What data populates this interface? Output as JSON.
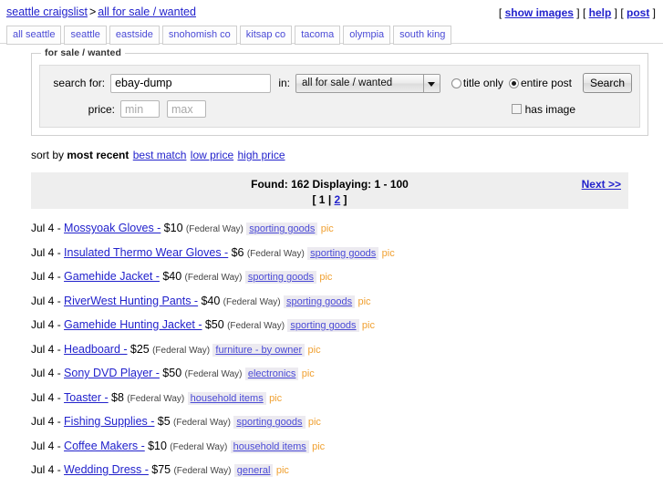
{
  "header": {
    "breadcrumb": {
      "site": "seattle craigslist",
      "separator": ">",
      "section": "all for sale / wanted"
    },
    "top_links": [
      {
        "label": "show images"
      },
      {
        "label": "help"
      },
      {
        "label": "post"
      }
    ]
  },
  "city_nav": [
    {
      "label": "all seattle"
    },
    {
      "label": "seattle"
    },
    {
      "label": "eastside"
    },
    {
      "label": "snohomish co"
    },
    {
      "label": "kitsap co"
    },
    {
      "label": "tacoma"
    },
    {
      "label": "olympia"
    },
    {
      "label": "south king"
    }
  ],
  "search_form": {
    "legend": "for sale / wanted",
    "search_for_label": "search for:",
    "query_value": "ebay-dump",
    "in_label": "in:",
    "category_selected": "all for sale / wanted",
    "scope_options": [
      {
        "label": "title only",
        "selected": false
      },
      {
        "label": "entire post",
        "selected": true
      }
    ],
    "search_button": "Search",
    "price_label": "price:",
    "price_min_placeholder": "min",
    "price_max_placeholder": "max",
    "has_image_label": "has image",
    "has_image_checked": false
  },
  "sort": {
    "prefix": "sort by",
    "current": "most recent",
    "options": [
      {
        "label": "best match"
      },
      {
        "label": "low price"
      },
      {
        "label": "high price"
      }
    ]
  },
  "results_bar": {
    "summary": "Found: 162 Displaying: 1 - 100",
    "pages_open": "[",
    "pages_close": "]",
    "pages_sep": "|",
    "page_current": "1",
    "page_other": "2",
    "next_label": "Next >>"
  },
  "listings": [
    {
      "date": "Jul 4",
      "dash": "-",
      "title": "Mossyoak Gloves -",
      "price": "$10",
      "location": "(Federal Way)",
      "category": "sporting goods",
      "pic": "pic"
    },
    {
      "date": "Jul 4",
      "dash": "-",
      "title": "Insulated Thermo Wear Gloves -",
      "price": "$6",
      "location": "(Federal Way)",
      "category": "sporting goods",
      "pic": "pic"
    },
    {
      "date": "Jul 4",
      "dash": "-",
      "title": "Gamehide Jacket -",
      "price": "$40",
      "location": "(Federal Way)",
      "category": "sporting goods",
      "pic": "pic"
    },
    {
      "date": "Jul 4",
      "dash": "-",
      "title": "RiverWest Hunting Pants -",
      "price": "$40",
      "location": "(Federal Way)",
      "category": "sporting goods",
      "pic": "pic"
    },
    {
      "date": "Jul 4",
      "dash": "-",
      "title": "Gamehide Hunting Jacket -",
      "price": "$50",
      "location": "(Federal Way)",
      "category": "sporting goods",
      "pic": "pic"
    },
    {
      "date": "Jul 4",
      "dash": "-",
      "title": "Headboard -",
      "price": "$25",
      "location": "(Federal Way)",
      "category": "furniture - by owner",
      "pic": "pic"
    },
    {
      "date": "Jul 4",
      "dash": "-",
      "title": "Sony DVD Player -",
      "price": "$50",
      "location": "(Federal Way)",
      "category": "electronics",
      "pic": "pic"
    },
    {
      "date": "Jul 4",
      "dash": "-",
      "title": "Toaster -",
      "price": "$8",
      "location": "(Federal Way)",
      "category": "household items",
      "pic": "pic"
    },
    {
      "date": "Jul 4",
      "dash": "-",
      "title": "Fishing Supplies -",
      "price": "$5",
      "location": "(Federal Way)",
      "category": "sporting goods",
      "pic": "pic"
    },
    {
      "date": "Jul 4",
      "dash": "-",
      "title": "Coffee Makers -",
      "price": "$10",
      "location": "(Federal Way)",
      "category": "household items",
      "pic": "pic"
    },
    {
      "date": "Jul 4",
      "dash": "-",
      "title": "Wedding Dress -",
      "price": "$75",
      "location": "(Federal Way)",
      "category": "general",
      "pic": "pic"
    }
  ],
  "colors": {
    "link": "#2222cc",
    "nav_text": "#4a4ad6",
    "pic": "#f0a030",
    "tag_bg": "#eceaf0",
    "bar_bg": "#eeeeee"
  }
}
